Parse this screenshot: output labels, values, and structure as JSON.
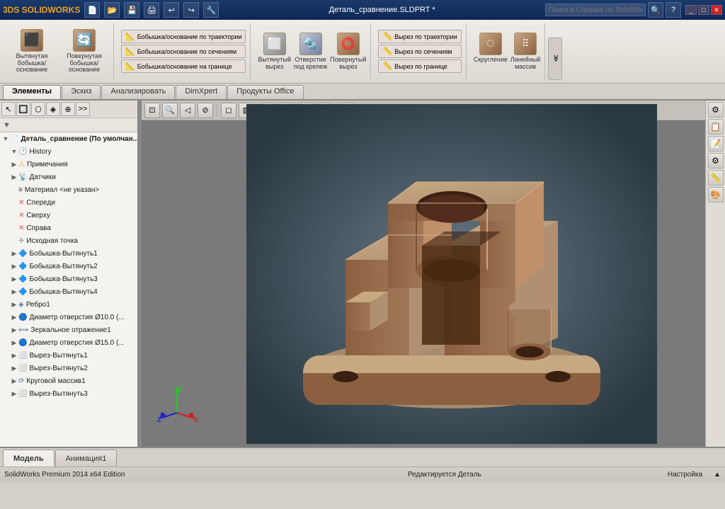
{
  "app": {
    "logo": "3DS SOLIDWORKS",
    "title": "Деталь_сравнение.SLDPRT *",
    "search_placeholder": "Поиск в Справке по SolidWorks"
  },
  "toolbar": {
    "groups": [
      {
        "items": [
          {
            "id": "extrude-boss",
            "label": "Вытянутая\nбобышка/основание",
            "icon": "⬛"
          },
          {
            "id": "revolve-boss",
            "label": "Повернутая\nбобышка/основание",
            "icon": "🔄"
          }
        ]
      },
      {
        "items": [
          {
            "id": "boss-sweep",
            "label": "Бобышка/основание по траектории",
            "icon": "📐"
          },
          {
            "id": "boss-loft",
            "label": "Бобышка/основание по сечениям",
            "icon": "📐"
          },
          {
            "id": "boss-boundary",
            "label": "Бобышка/основание на границе",
            "icon": "📐"
          }
        ]
      },
      {
        "items": [
          {
            "id": "extrude-cut",
            "label": "Вытянутый\nвырез",
            "icon": "⬜"
          },
          {
            "id": "hole-wizard",
            "label": "Отверстие\nпод крепеж",
            "icon": "🔩"
          },
          {
            "id": "revolve-cut",
            "label": "Повернутый\nвырез",
            "icon": "⭕"
          }
        ]
      },
      {
        "items": [
          {
            "id": "cut-sweep",
            "label": "Вырез по траектории",
            "icon": "📏"
          },
          {
            "id": "cut-loft",
            "label": "Вырез по сечениям",
            "icon": "📏"
          },
          {
            "id": "cut-boundary",
            "label": "Вырез по границе",
            "icon": "📏"
          }
        ]
      },
      {
        "items": [
          {
            "id": "fillet",
            "label": "Скругление",
            "icon": "◯"
          },
          {
            "id": "linear-pattern",
            "label": "Линейный\nмассив",
            "icon": "⬛"
          }
        ]
      }
    ]
  },
  "tabs": [
    {
      "id": "elements",
      "label": "Элементы",
      "active": true
    },
    {
      "id": "sketch",
      "label": "Эскиз"
    },
    {
      "id": "analyze",
      "label": "Анализировать"
    },
    {
      "id": "dimxpert",
      "label": "DimXpert"
    },
    {
      "id": "office",
      "label": "Продукты Office"
    }
  ],
  "sidebar": {
    "toolbar_buttons": [
      "↑",
      "↓",
      "🔍",
      "✎",
      "⚙",
      "≡",
      "🖱",
      "📌",
      ">>"
    ],
    "filter_placeholder": "▼",
    "tree": [
      {
        "id": "root",
        "label": "Деталь_сравнение (По умолчан...",
        "icon": "📄",
        "level": 0,
        "expand": true
      },
      {
        "id": "history",
        "label": "History",
        "icon": "📋",
        "level": 1,
        "expand": true
      },
      {
        "id": "notes",
        "label": "Примечания",
        "icon": "📝",
        "level": 1,
        "expand": false
      },
      {
        "id": "sensors",
        "label": "Датчики",
        "icon": "📡",
        "level": 1,
        "expand": false
      },
      {
        "id": "material",
        "label": "Материал <не указан>",
        "icon": "⬛",
        "level": 1,
        "expand": false
      },
      {
        "id": "front",
        "label": "Спереди",
        "icon": "⊞",
        "level": 1,
        "expand": false
      },
      {
        "id": "top",
        "label": "Сверху",
        "icon": "⊞",
        "level": 1,
        "expand": false
      },
      {
        "id": "right",
        "label": "Справа",
        "icon": "⊞",
        "level": 1,
        "expand": false
      },
      {
        "id": "origin",
        "label": "Исходная точка",
        "icon": "✛",
        "level": 1,
        "expand": false
      },
      {
        "id": "boss1",
        "label": "Бобышка-Вытянуть1",
        "icon": "⬛",
        "level": 1,
        "expand": false
      },
      {
        "id": "boss2",
        "label": "Бобышка-Вытянуть2",
        "icon": "⬛",
        "level": 1,
        "expand": false
      },
      {
        "id": "boss3",
        "label": "Бобышка-Вытянуть3",
        "icon": "⬛",
        "level": 1,
        "expand": false
      },
      {
        "id": "boss4",
        "label": "Бобышка-Вытянуть4",
        "icon": "⬛",
        "level": 1,
        "expand": false
      },
      {
        "id": "rib1",
        "label": "Ребро1",
        "icon": "◈",
        "level": 1,
        "expand": false
      },
      {
        "id": "hole10",
        "label": "Диаметр отверстия Ø10.0 (...",
        "icon": "🔵",
        "level": 1,
        "expand": false
      },
      {
        "id": "mirror1",
        "label": "Зеркальное отражение1",
        "icon": "⟺",
        "level": 1,
        "expand": false
      },
      {
        "id": "hole15",
        "label": "Диаметр отверстия Ø15.0 (...",
        "icon": "🔵",
        "level": 1,
        "expand": false
      },
      {
        "id": "cut1",
        "label": "Вырез-Вытянуть1",
        "icon": "⬜",
        "level": 1,
        "expand": false
      },
      {
        "id": "cut2",
        "label": "Вырез-Вытянуть2",
        "icon": "⬜",
        "level": 1,
        "expand": false
      },
      {
        "id": "pattern1",
        "label": "Круговой массив1",
        "icon": "⟳",
        "level": 1,
        "expand": false
      },
      {
        "id": "cut3",
        "label": "Вырез-Вытянуть3",
        "icon": "⬜",
        "level": 1,
        "expand": false
      }
    ]
  },
  "viewport": {
    "toolbar_buttons": [
      {
        "id": "zoom-to-fit",
        "icon": "⊡"
      },
      {
        "id": "zoom-in",
        "icon": "🔍"
      },
      {
        "id": "zoom-out",
        "icon": "🔍"
      },
      {
        "id": "rotate",
        "icon": "↻"
      },
      {
        "id": "pan",
        "icon": "✋"
      },
      {
        "id": "section-view",
        "icon": "⊘"
      },
      {
        "id": "view-orientation",
        "icon": "◻"
      },
      {
        "id": "display-style",
        "icon": "🎨"
      },
      {
        "id": "hide-show",
        "icon": "👁"
      },
      {
        "id": "lighting",
        "icon": "💡"
      },
      {
        "id": "scene",
        "icon": "🌐"
      },
      {
        "id": "camera",
        "icon": "📷"
      }
    ]
  },
  "side_panel_buttons": [
    {
      "id": "view-settings",
      "icon": "⚙"
    },
    {
      "id": "display-manager",
      "icon": "📋"
    },
    {
      "id": "property-manager",
      "icon": "📝"
    },
    {
      "id": "configuration-manager",
      "icon": "⚙"
    },
    {
      "id": "dime-xpert",
      "icon": "📏"
    },
    {
      "id": "appearance",
      "icon": "🎨"
    }
  ],
  "bottom_tabs": [
    {
      "id": "model",
      "label": "Модель",
      "active": true
    },
    {
      "id": "animation",
      "label": "Анимация1"
    }
  ],
  "statusbar": {
    "left": "SolidWorks Premium 2014 x64 Edition",
    "center": "Редактируется Деталь",
    "right": "Настройка",
    "arrow": "▲"
  },
  "colors": {
    "model_light": "#c8a882",
    "model_dark": "#6b4a30",
    "model_mid": "#b08060",
    "bg_gradient_start": "#5a6a7a",
    "bg_gradient_end": "#2a3840"
  }
}
